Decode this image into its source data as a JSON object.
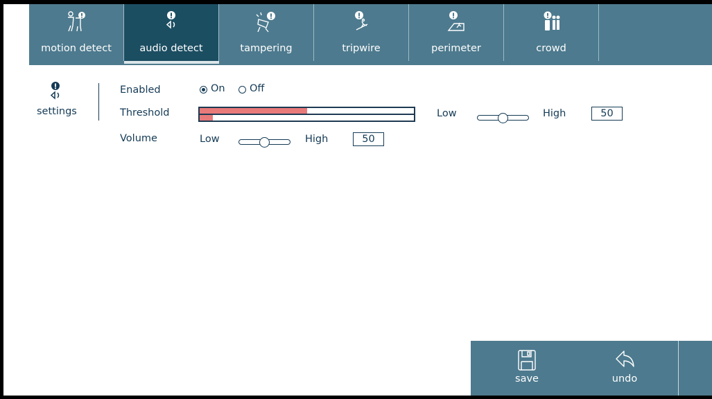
{
  "tabs": [
    {
      "label": "motion detect",
      "icon": "motion-detect-icon"
    },
    {
      "label": "audio detect",
      "icon": "audio-detect-icon",
      "active": true
    },
    {
      "label": "tampering",
      "icon": "tampering-icon"
    },
    {
      "label": "tripwire",
      "icon": "tripwire-icon"
    },
    {
      "label": "perimeter",
      "icon": "perimeter-icon"
    },
    {
      "label": "crowd",
      "icon": "crowd-icon"
    }
  ],
  "section": {
    "label": "settings",
    "icon": "audio-settings-icon"
  },
  "enabled": {
    "label": "Enabled",
    "on_label": "On",
    "off_label": "Off",
    "value": "On"
  },
  "threshold": {
    "label": "Threshold",
    "low_label": "Low",
    "high_label": "High",
    "value": "50",
    "meter_threshold_fraction": 0.5,
    "meter_level_fraction": 0.06
  },
  "volume": {
    "label": "Volume",
    "low_label": "Low",
    "high_label": "High",
    "value": "50"
  },
  "actions": {
    "save_label": "save",
    "undo_label": "undo"
  },
  "colors": {
    "bar": "#4d7a8e",
    "active_tab": "#1c4e62",
    "text": "#143a55",
    "meter_fill": "#e87a7a"
  }
}
